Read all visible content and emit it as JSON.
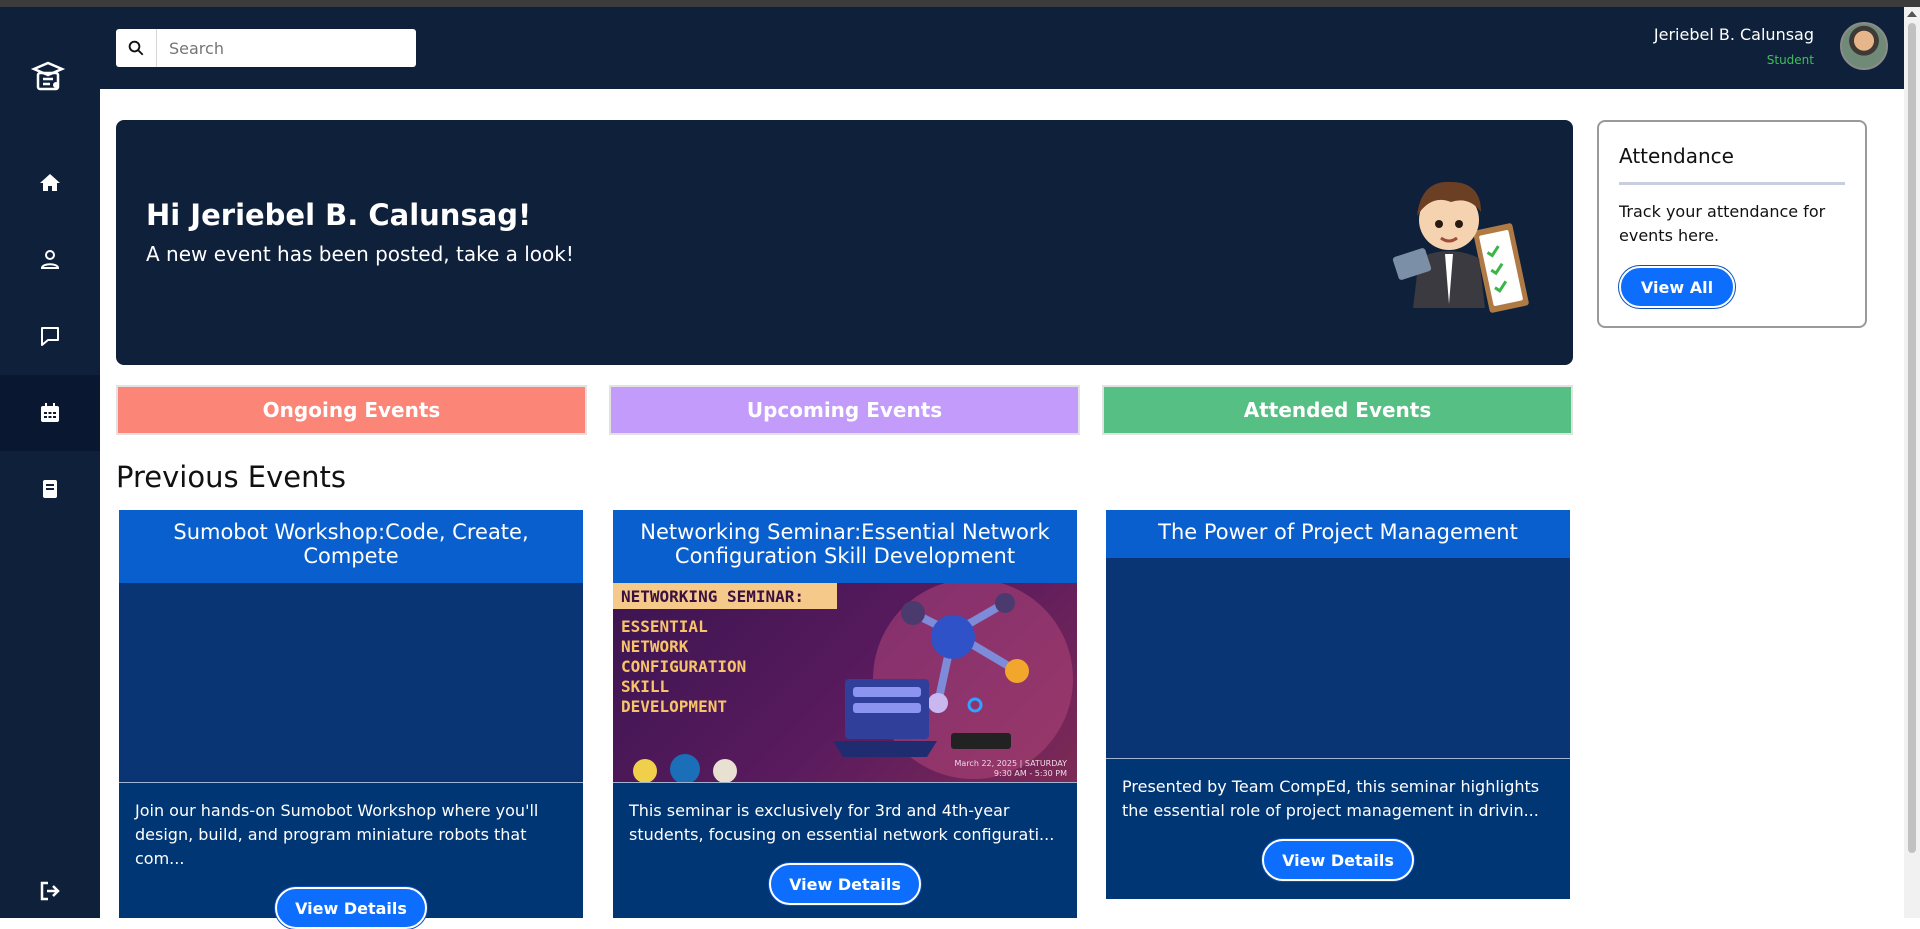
{
  "search": {
    "placeholder": "Search"
  },
  "user": {
    "name": "Jeriebel B. Calunsag",
    "role": "Student"
  },
  "sidebar": {
    "items": [
      {
        "icon": "home-icon"
      },
      {
        "icon": "user-icon"
      },
      {
        "icon": "chat-icon"
      },
      {
        "icon": "calendar-icon",
        "active": true
      },
      {
        "icon": "book-icon"
      }
    ],
    "logout_icon": "logout-icon"
  },
  "hero": {
    "title": "Hi Jeriebel B. Calunsag!",
    "subtitle": "A new event has been posted, take a look!"
  },
  "attendance": {
    "title": "Attendance",
    "text": "Track your attendance for events here.",
    "button": "View All"
  },
  "tabs": {
    "ongoing": "Ongoing Events",
    "upcoming": "Upcoming Events",
    "attended": "Attended Events"
  },
  "section_title": "Previous Events",
  "cards": [
    {
      "title": "Sumobot Workshop:Code, Create, Compete",
      "description": "Join our hands-on Sumobot Workshop where you'll design, build, and program miniature robots that com...",
      "button": "View Details"
    },
    {
      "title": "Networking Seminar:Essential Network Configuration Skill Development",
      "description": "This seminar is exclusively for 3rd and 4th-year students, focusing on essential network configurati...",
      "button": "View Details",
      "poster": {
        "heading": "NETWORKING SEMINAR:",
        "lines": [
          "ESSENTIAL",
          "NETWORK",
          "CONFIGURATION",
          "SKILL",
          "DEVELOPMENT"
        ],
        "date": "March 22, 2025 | SATURDAY",
        "time": "9:30 AM - 5:30 PM"
      }
    },
    {
      "title": "The Power of Project Management",
      "description": "Presented by Team CompEd, this seminar highlights the essential role of project management in drivin...",
      "button": "View Details"
    }
  ],
  "colors": {
    "navy": "#0f203a",
    "accent_blue": "#0d6efd",
    "card_blue": "#013675",
    "card_header": "#0a5fcf",
    "ongoing": "#fb8577",
    "upcoming": "#c39bfb",
    "attended": "#56c084",
    "role_green": "#3fbf5a"
  }
}
